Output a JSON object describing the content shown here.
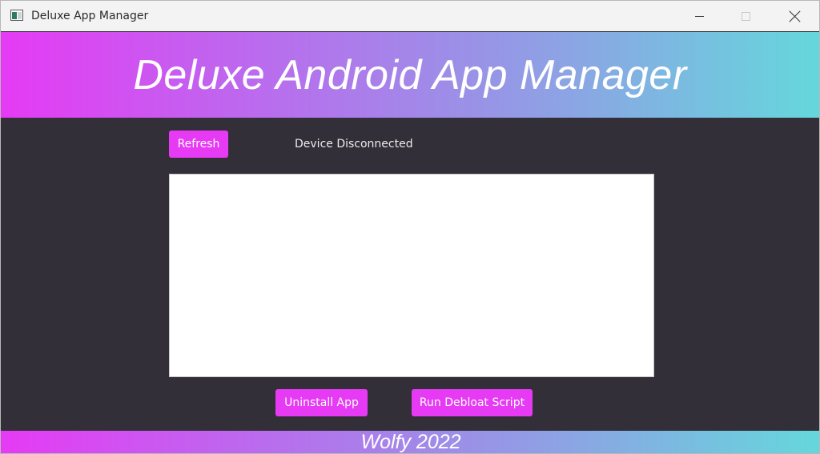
{
  "window": {
    "title": "Deluxe App Manager",
    "app_icon": "app-window-icon",
    "controls": {
      "minimize_icon": "minimize-icon",
      "maximize_icon": "maximize-icon",
      "close_icon": "close-icon"
    }
  },
  "header": {
    "title": "Deluxe Android App Manager"
  },
  "toolbar": {
    "refresh_label": "Refresh",
    "status": "Device Disconnected"
  },
  "app_list": {
    "items": []
  },
  "actions": {
    "uninstall_label": "Uninstall App",
    "debloat_label": "Run Debloat Script"
  },
  "footer": {
    "text": "Wolfy 2022"
  },
  "colors": {
    "accent": "#e63af4",
    "background": "#322f38",
    "gradient_start": "#e63af4",
    "gradient_end": "#65d7dc",
    "titlebar": "#f3f3f3"
  }
}
